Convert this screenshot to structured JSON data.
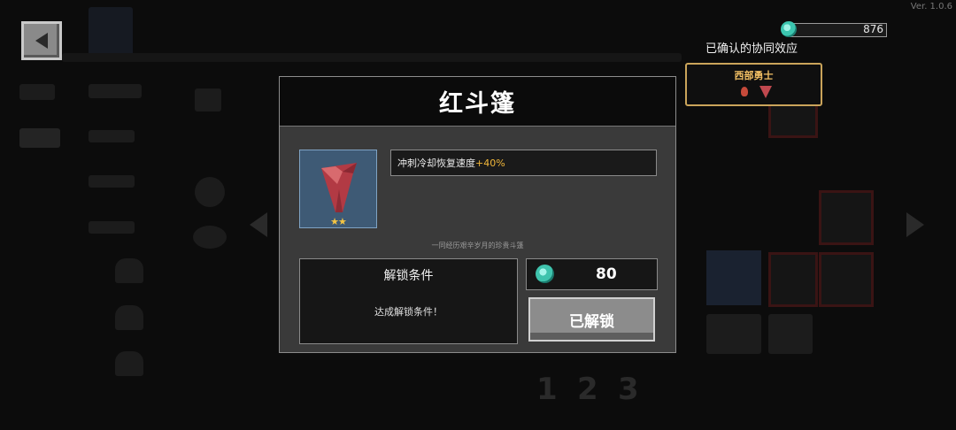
{
  "version": "Ver. 1.0.6",
  "currency": {
    "amount": "876",
    "icon": "gem-icon"
  },
  "synergy": {
    "title": "已确认的协同效应",
    "card_name": "西部勇士"
  },
  "dialog": {
    "title": "红斗篷",
    "item_stars": "★★",
    "stat_text": "冲刺冷却恢复速度",
    "stat_bonus": "+40%",
    "flavor": "一同经历艰辛岁月的珍贵斗篷",
    "unlock_label": "解锁条件",
    "unlock_condition": "达成解锁条件！",
    "price": "80",
    "unlocked_button": "已解锁"
  },
  "colors": {
    "accent_gold": "#f2b73a",
    "synergy_border": "#caa45a",
    "item_slot_bg": "#3e5a75",
    "gem": "#3cc6b0"
  }
}
